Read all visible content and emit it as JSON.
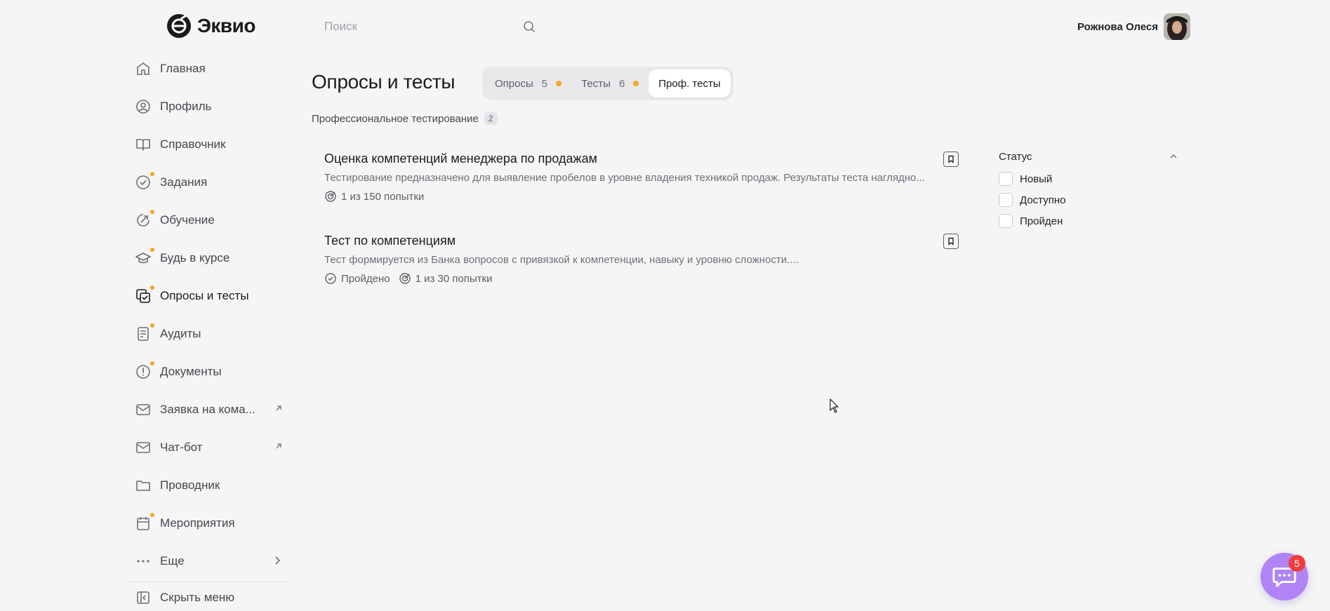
{
  "header": {
    "logo_text": "Эквио",
    "search_placeholder": "Поиск",
    "user_name": "Рожнова Олеся"
  },
  "sidebar": {
    "items": [
      {
        "label": "Главная",
        "icon": "home-icon",
        "dot": false
      },
      {
        "label": "Профиль",
        "icon": "profile-icon",
        "dot": false
      },
      {
        "label": "Справочник",
        "icon": "book-icon",
        "dot": false
      },
      {
        "label": "Задания",
        "icon": "check-circle-icon",
        "dot": true
      },
      {
        "label": "Обучение",
        "icon": "learning-icon",
        "dot": true
      },
      {
        "label": "Будь в курсе",
        "icon": "graduation-cap-icon",
        "dot": true
      },
      {
        "label": "Опросы и тесты",
        "icon": "survey-icon",
        "dot": true,
        "active": true
      },
      {
        "label": "Аудиты",
        "icon": "audit-icon",
        "dot": true
      },
      {
        "label": "Документы",
        "icon": "document-alert-icon",
        "dot": true
      },
      {
        "label": "Заявка на кома...",
        "icon": "mail-icon",
        "dot": false,
        "external": true
      },
      {
        "label": "Чат-бот",
        "icon": "mail-icon",
        "dot": false,
        "external": true
      },
      {
        "label": "Проводник",
        "icon": "folder-icon",
        "dot": false
      },
      {
        "label": "Мероприятия",
        "icon": "calendar-icon",
        "dot": true
      },
      {
        "label": "Еще",
        "icon": "more-icon",
        "dot": false,
        "chevron": true
      }
    ],
    "hide_label": "Скрыть меню"
  },
  "main": {
    "title": "Опросы и тесты",
    "tabs": [
      {
        "label": "Опросы",
        "count": "5",
        "dot": true
      },
      {
        "label": "Тесты",
        "count": "6",
        "dot": true
      },
      {
        "label": "Проф. тесты",
        "active": true
      }
    ],
    "section": {
      "title": "Профессиональное тестирование",
      "count": "2"
    },
    "cards": [
      {
        "title": "Оценка компетенций менеджера по продажам",
        "description": "Тестирование предназначено для выявление пробелов в уровне владения техникой продаж. Результаты теста наглядно...",
        "attempts": "1 из 150 попытки"
      },
      {
        "title": "Тест по компетенциям",
        "description": "Тест формируется из Банка вопросов с привязкой к компетенции, навыку и уровню сложности....",
        "status": "Пройдено",
        "attempts": "1 из 30 попытки"
      }
    ]
  },
  "filter": {
    "title": "Статус",
    "options": [
      "Новый",
      "Доступно",
      "Пройден"
    ]
  },
  "chat": {
    "badge": "5"
  },
  "colors": {
    "accent_dot": "#f6a623",
    "chat_fab": "#b084f5",
    "badge": "#f03d3d",
    "background": "#f5f5f6"
  }
}
